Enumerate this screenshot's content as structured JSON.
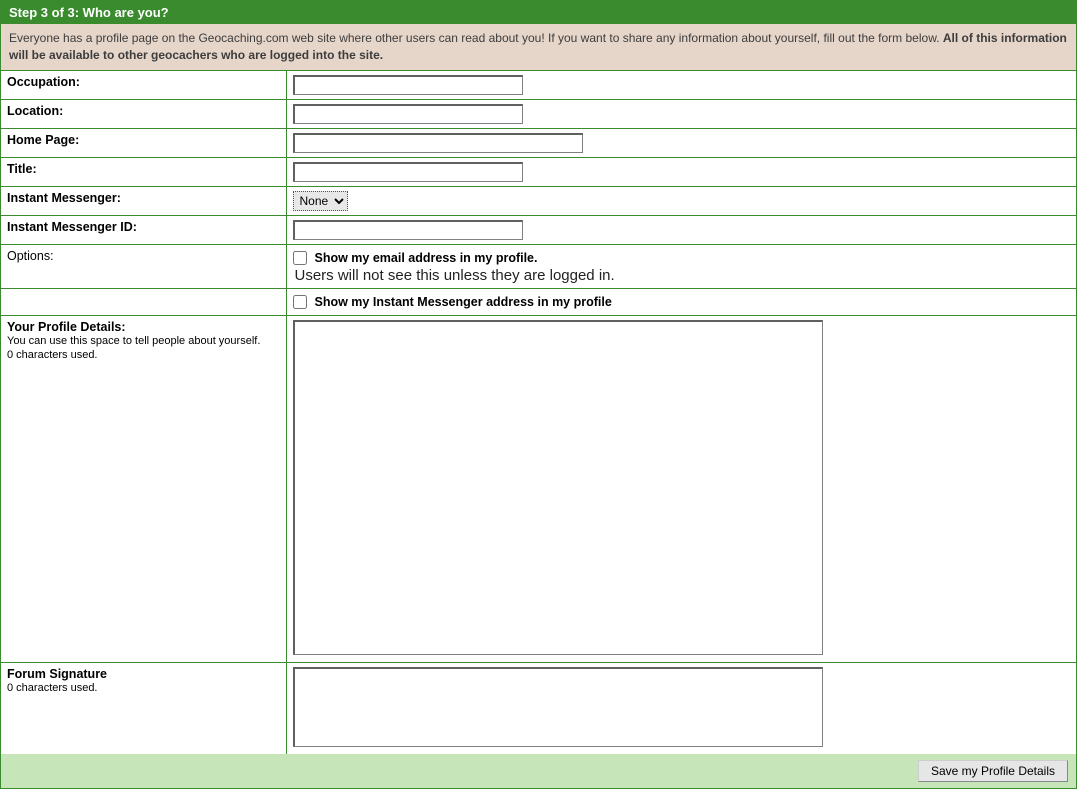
{
  "header": "Step 3 of 3: Who are you?",
  "intro": {
    "text": "Everyone has a profile page on the Geocaching.com web site where other users can read about you! If you want to share any information about yourself, fill out the form below. ",
    "bold": "All of this information will be available to other geocachers who are logged into the site."
  },
  "fields": {
    "occupation": {
      "label": "Occupation:",
      "value": ""
    },
    "location": {
      "label": "Location:",
      "value": ""
    },
    "homepage": {
      "label": "Home Page:",
      "value": ""
    },
    "title": {
      "label": "Title:",
      "value": ""
    },
    "im": {
      "label": "Instant Messenger:",
      "selected": "None"
    },
    "imid": {
      "label": "Instant Messenger ID:",
      "value": ""
    },
    "options": {
      "label": "Options:"
    },
    "opt_email": {
      "label": "Show my email address in my profile.",
      "note": "Users will not see this unless they are logged in."
    },
    "opt_im": {
      "label": "Show my Instant Messenger address in my profile"
    },
    "details": {
      "label": "Your Profile Details:",
      "sub1": "You can use this space to tell people about yourself.",
      "sub2": "0 characters used.",
      "value": ""
    },
    "sig": {
      "label": "Forum Signature",
      "sub": "0 characters used.",
      "value": ""
    }
  },
  "footer": {
    "save": "Save my Profile Details"
  }
}
